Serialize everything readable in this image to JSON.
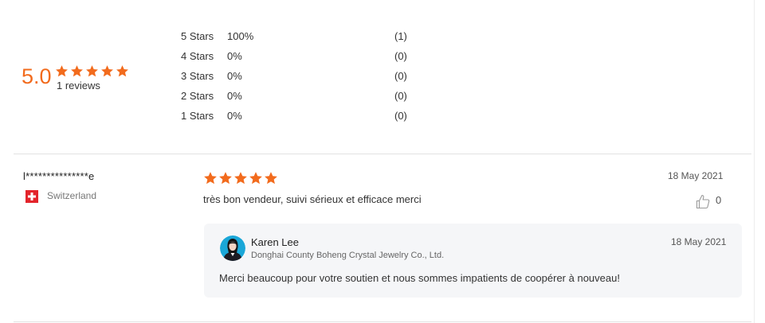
{
  "summary": {
    "average": "5.0",
    "rating": 5,
    "review_count": "1 reviews",
    "distribution": [
      {
        "label": "5 Stars",
        "percent": "100%",
        "count": "(1)"
      },
      {
        "label": "4 Stars",
        "percent": "0%",
        "count": "(0)"
      },
      {
        "label": "3 Stars",
        "percent": "0%",
        "count": "(0)"
      },
      {
        "label": "2 Stars",
        "percent": "0%",
        "count": "(0)"
      },
      {
        "label": "1 Stars",
        "percent": "0%",
        "count": "(0)"
      }
    ]
  },
  "review": {
    "reviewer": "l***************e",
    "country": "Switzerland",
    "flag_icon": "switzerland-flag-icon",
    "rating": 5,
    "date": "18 May 2021",
    "text": "très bon vendeur, suivi sérieux et efficace merci",
    "likes": "0",
    "reply": {
      "name": "Karen Lee",
      "company": "Donghai County Boheng Crystal Jewelry Co., Ltd.",
      "date": "18 May 2021",
      "text": "Merci beaucoup pour votre soutien et nous sommes impatients de coopérer à nouveau!"
    }
  },
  "colors": {
    "accent": "#f26b1d",
    "reply_background": "#f5f6f8",
    "divider": "#e2e2e2",
    "flag_red": "#e3242b"
  }
}
